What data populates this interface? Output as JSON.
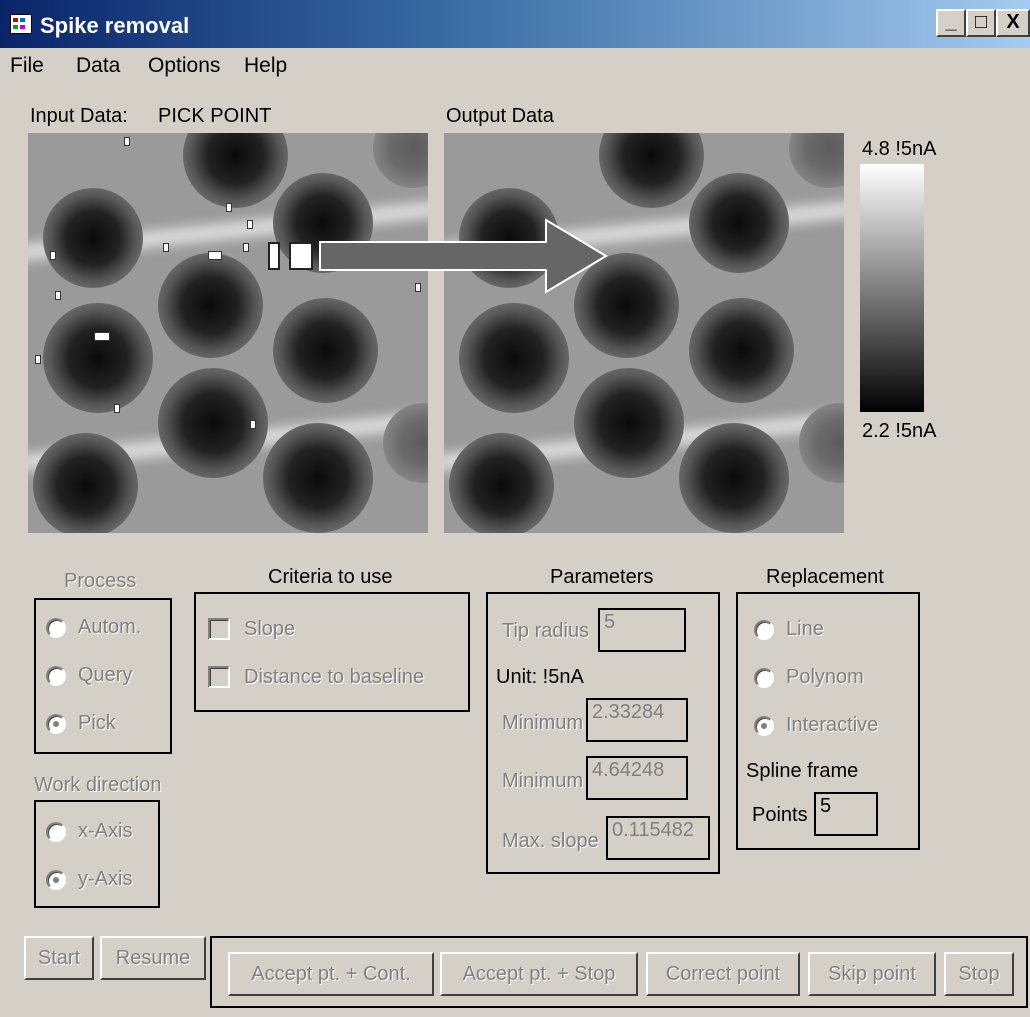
{
  "window": {
    "title": "Spike removal",
    "controls": {
      "minimize": "_",
      "maximize": "□",
      "close": "X"
    }
  },
  "menu": [
    "File",
    "Data",
    "Options",
    "Help"
  ],
  "input_panel": {
    "label": "Input Data:",
    "mode": "PICK POINT"
  },
  "output_panel": {
    "label": "Output Data"
  },
  "colorbar": {
    "max_label": "4.8 !5nA",
    "min_label": "2.2 !5nA"
  },
  "process": {
    "title": "Process",
    "options": [
      "Autom.",
      "Query",
      "Pick"
    ],
    "selected": "Pick"
  },
  "work_direction": {
    "title": "Work direction",
    "options": [
      "x-Axis",
      "y-Axis"
    ],
    "selected": "y-Axis"
  },
  "criteria": {
    "title": "Criteria to use",
    "options": [
      "Slope",
      "Distance to baseline"
    ]
  },
  "parameters": {
    "title": "Parameters",
    "tip_radius_label": "Tip radius",
    "tip_radius_value": "5",
    "unit_label": "Unit: !5nA",
    "minimum1_label": "Minimum",
    "minimum1_value": "2.33284",
    "minimum2_label": "Minimum",
    "minimum2_value": "4.64248",
    "max_slope_label": "Max. slope",
    "max_slope_value": "0.115482"
  },
  "replacement": {
    "title": "Replacement",
    "options": [
      "Line",
      "Polynom",
      "Interactive"
    ],
    "selected": "Interactive",
    "spline_frame_label": "Spline frame",
    "points_label": "Points",
    "points_value": "5"
  },
  "buttons": {
    "start": "Start",
    "resume": "Resume",
    "accept_cont": "Accept pt. + Cont.",
    "accept_stop": "Accept pt. + Stop",
    "correct": "Correct point",
    "skip": "Skip point",
    "stop": "Stop"
  },
  "colors": {
    "title_bar_start": "#0a246a",
    "title_bar_end": "#a6caf0",
    "window_bg": "#d4d0c8",
    "disabled_text": "#808080"
  }
}
